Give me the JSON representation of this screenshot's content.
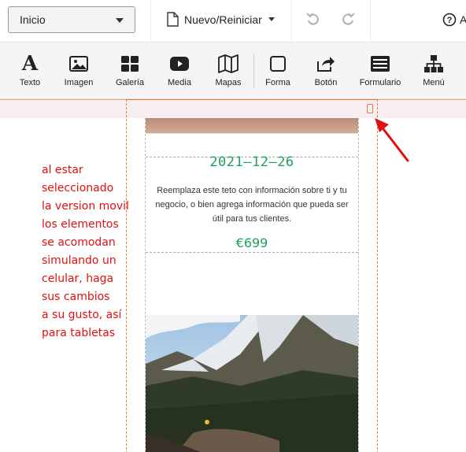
{
  "topbar": {
    "page_select": "Inicio",
    "new_reset": "Nuevo/Reiniciar",
    "help_label": "A"
  },
  "toolbar": {
    "items": [
      {
        "label": "Texto",
        "icon": "text-icon"
      },
      {
        "label": "Imagen",
        "icon": "image-icon"
      },
      {
        "label": "Galería",
        "icon": "gallery-icon"
      },
      {
        "label": "Media",
        "icon": "media-icon"
      },
      {
        "label": "Mapas",
        "icon": "map-icon"
      },
      {
        "label": "Forma",
        "icon": "shape-icon"
      },
      {
        "label": "Botón",
        "icon": "share-button-icon"
      },
      {
        "label": "Formulario",
        "icon": "form-icon"
      },
      {
        "label": "Menú",
        "icon": "sitemap-icon"
      }
    ]
  },
  "content": {
    "date": "2021–12–26",
    "description": "Reemplaza este teto con información sobre ti y tu negocio, o bien agrega información que pueda ser útil para tus clientes.",
    "price": "€699"
  },
  "annotation": {
    "lines": [
      "al estar",
      "seleccionado",
      "la version movil",
      "los elementos",
      "se acomodan",
      "simulando un",
      "celular, haga",
      "sus cambios",
      "a su gusto, así",
      "para tabletas"
    ]
  },
  "colors": {
    "accent_green": "#1aa35a",
    "frame_orange": "#e27b3d",
    "annotation_red": "#e01010"
  }
}
